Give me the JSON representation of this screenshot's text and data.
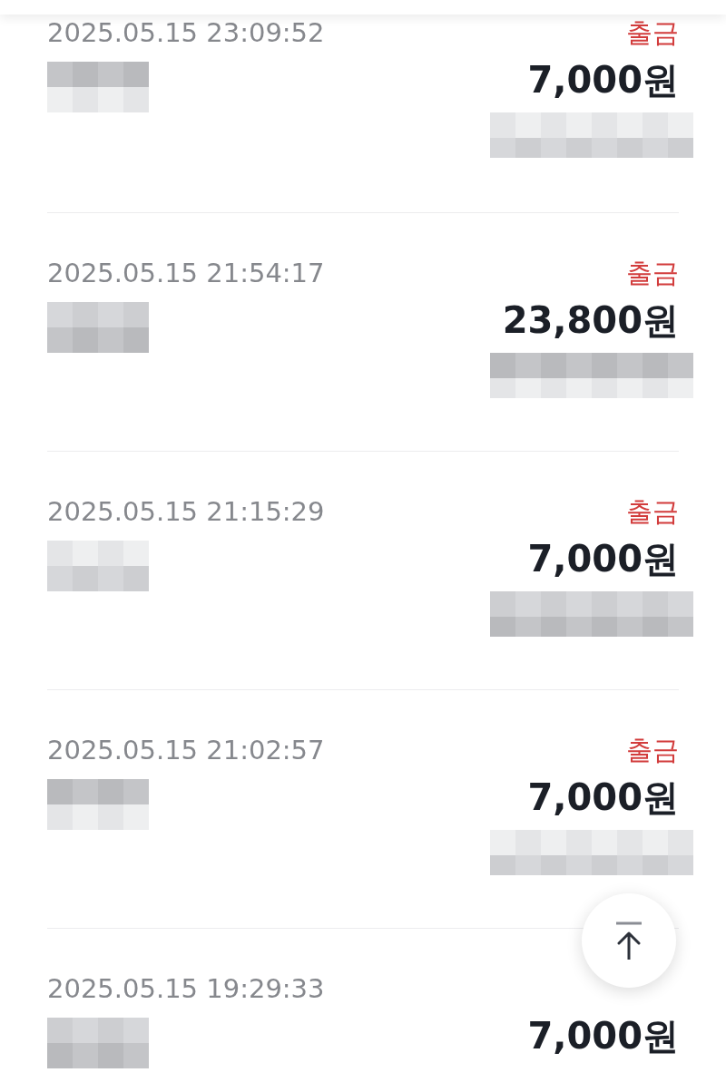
{
  "transactions": [
    {
      "datetime": "2025.05.15 23:09:52",
      "type": "출금",
      "amount": "7,000원"
    },
    {
      "datetime": "2025.05.15 21:54:17",
      "type": "출금",
      "amount": "23,800원"
    },
    {
      "datetime": "2025.05.15 21:15:29",
      "type": "출금",
      "amount": "7,000원"
    },
    {
      "datetime": "2025.05.15 21:02:57",
      "type": "출금",
      "amount": "7,000원"
    },
    {
      "datetime": "2025.05.15 19:29:33",
      "amount": "7,000원"
    }
  ]
}
